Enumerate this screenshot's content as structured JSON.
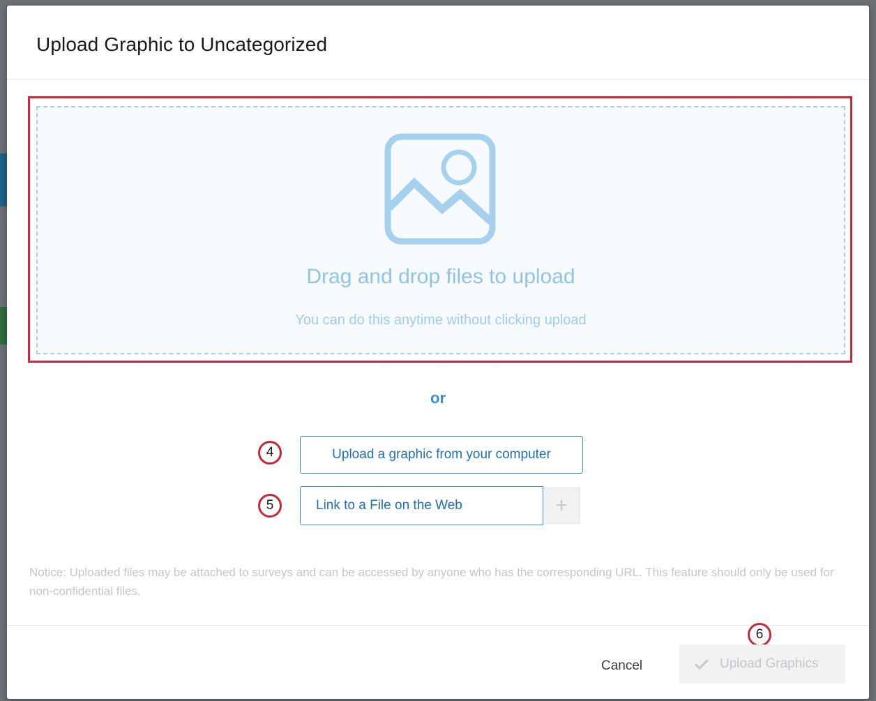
{
  "modal": {
    "title": "Upload Graphic to Uncategorized"
  },
  "dropzone": {
    "icon": "image-icon",
    "title": "Drag and drop files to upload",
    "subtitle": "You can do this anytime without clicking upload"
  },
  "divider_text": "or",
  "actions": {
    "upload_computer_label": "Upload a graphic from your computer",
    "link_web_label": "Link to a File on the Web",
    "add_link_icon": "plus-icon"
  },
  "callouts": {
    "upload_computer": "4",
    "link_web": "5",
    "upload_graphics": "6"
  },
  "notice": "Notice: Uploaded files may be attached to surveys and can be accessed by anyone who has the corresponding URL. This feature should only be used for non-confidential files.",
  "footer": {
    "cancel_label": "Cancel",
    "upload_graphics_label": "Upload Graphics",
    "upload_graphics_icon": "check-icon"
  },
  "colors": {
    "accent": "#3b8fd0",
    "callout": "#c8283a",
    "dropzone_text": "#8fc3e8",
    "disabled": "#c4c8cc"
  }
}
